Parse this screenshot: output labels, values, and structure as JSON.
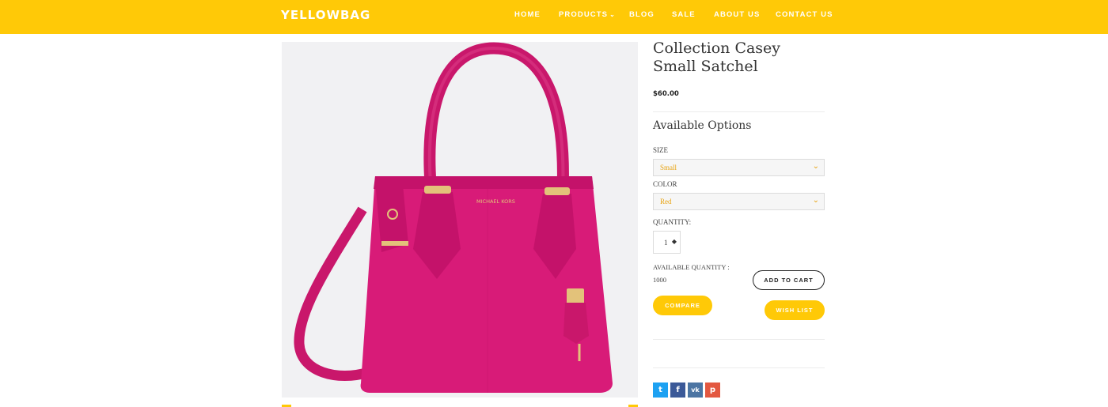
{
  "header": {
    "logo_main": "YELLOW",
    "logo_accent": "BAG",
    "nav": [
      {
        "label": "HOME"
      },
      {
        "label": "PRODUCTS",
        "has_dropdown": true
      },
      {
        "label": "BLOG"
      },
      {
        "label": "SALE"
      },
      {
        "label": "ABOUT US"
      },
      {
        "label": "CONTACT US"
      }
    ],
    "accent_color": "#ffc907"
  },
  "product": {
    "image_brand_text": "MICHAEL KORS",
    "bag_color": "#d81b78",
    "title": "Collection Casey Small Satchel",
    "price": "$60.00",
    "options_heading": "Available Options",
    "size_label": "SIZE",
    "size_selected": "Small",
    "color_label": "COLOR",
    "color_selected": "Red",
    "quantity_label": "QUANTITY:",
    "quantity_value": "1",
    "available_quantity_label": "AVAILABLE QUANTITY :",
    "available_quantity_value": "1000"
  },
  "buttons": {
    "add_to_cart": "ADD TO CART",
    "compare": "COMPARE",
    "wish_list": "WISH LIST"
  },
  "social": [
    {
      "name": "twitter",
      "glyph": "t",
      "color": "#1da1f2"
    },
    {
      "name": "facebook",
      "glyph": "f",
      "color": "#3b5998"
    },
    {
      "name": "vk",
      "glyph": "vk",
      "color": "#4c75a3"
    },
    {
      "name": "pinterest",
      "glyph": "p",
      "color": "#e35840"
    }
  ]
}
